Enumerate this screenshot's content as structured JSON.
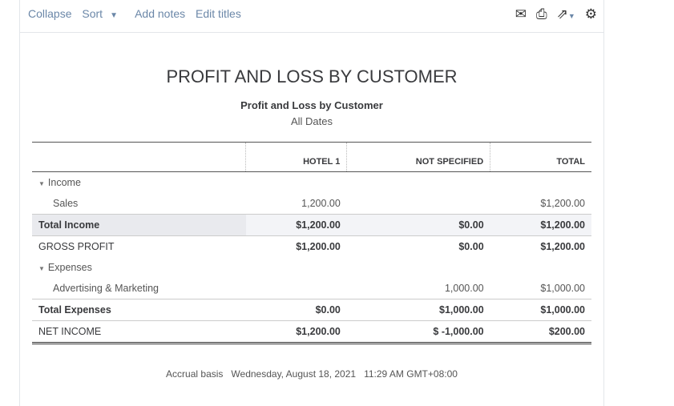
{
  "toolbar": {
    "collapse": "Collapse",
    "sort": "Sort",
    "add_notes": "Add notes",
    "edit_titles": "Edit titles"
  },
  "report": {
    "heading": "PROFIT AND LOSS BY CUSTOMER",
    "title": "Profit and Loss by Customer",
    "period": "All Dates"
  },
  "columns": [
    "HOTEL 1",
    "NOT SPECIFIED",
    "TOTAL"
  ],
  "rows": {
    "income": {
      "label": "Income"
    },
    "sales": {
      "label": "Sales",
      "values": [
        "1,200.00",
        "",
        "$1,200.00"
      ]
    },
    "total_income": {
      "label": "Total Income",
      "values": [
        "$1,200.00",
        "$0.00",
        "$1,200.00"
      ]
    },
    "gross_profit": {
      "label": "GROSS PROFIT",
      "values": [
        "$1,200.00",
        "$0.00",
        "$1,200.00"
      ]
    },
    "expenses": {
      "label": "Expenses"
    },
    "advertising": {
      "label": "Advertising & Marketing",
      "values": [
        "",
        "1,000.00",
        "$1,000.00"
      ]
    },
    "total_expenses": {
      "label": "Total Expenses",
      "values": [
        "$0.00",
        "$1,000.00",
        "$1,000.00"
      ]
    },
    "net_income": {
      "label": "NET INCOME",
      "values": [
        "$1,200.00",
        "$ -1,000.00",
        "$200.00"
      ]
    }
  },
  "footer": "Accrual basis   Wednesday, August 18, 2021   11:29 AM GMT+08:00"
}
